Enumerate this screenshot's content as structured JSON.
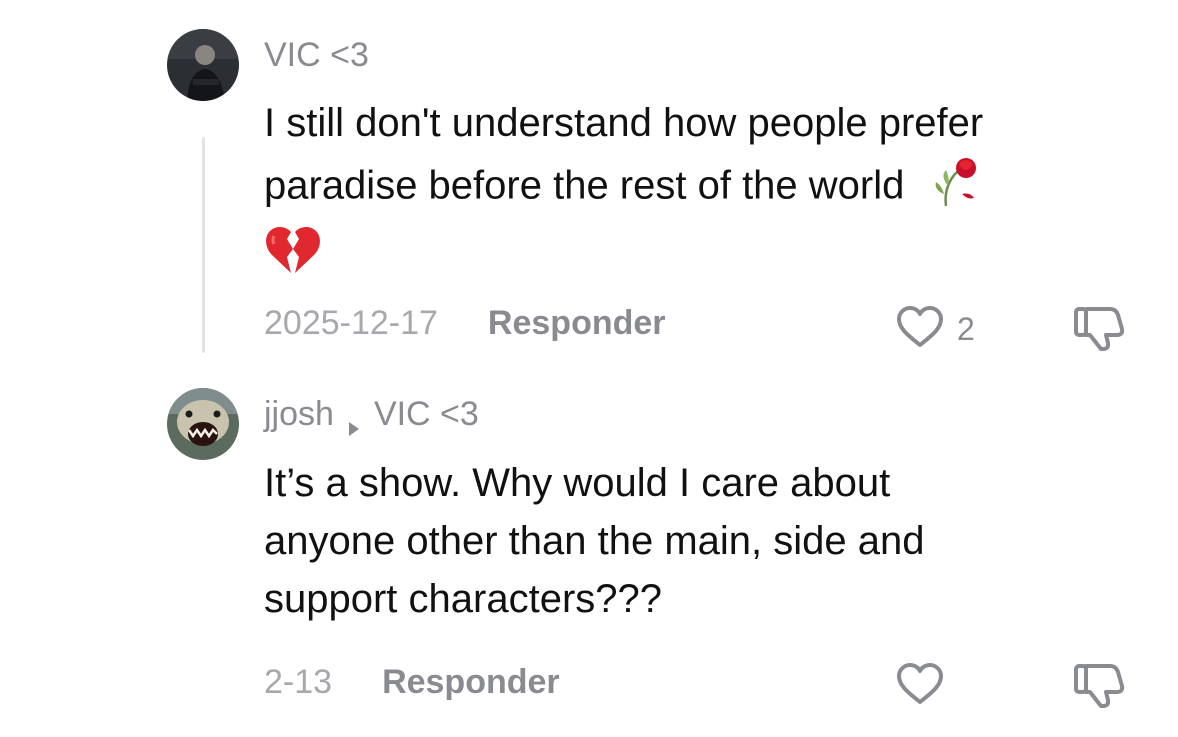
{
  "comments": [
    {
      "username": "VIC <3",
      "text_lines": [
        "I still don't understand how people prefer",
        "paradise before the rest of the world"
      ],
      "emojis": [
        "wilted-rose-icon",
        "broken-heart-icon"
      ],
      "date": "2025-12-17",
      "reply_label": "Responder",
      "like_count": "2"
    },
    {
      "username": "jjosh",
      "reply_to": "VIC <3",
      "text_lines": [
        "It’s a show. Why would I care about",
        "anyone other than the main, side and",
        "support characters???"
      ],
      "date": "2-13",
      "reply_label": "Responder"
    }
  ],
  "colors": {
    "username": "#8a8b91",
    "body_text": "#111111",
    "date": "#a7a8ad",
    "thread_line": "#e3e3e4",
    "broken_heart": "#e0282e"
  }
}
